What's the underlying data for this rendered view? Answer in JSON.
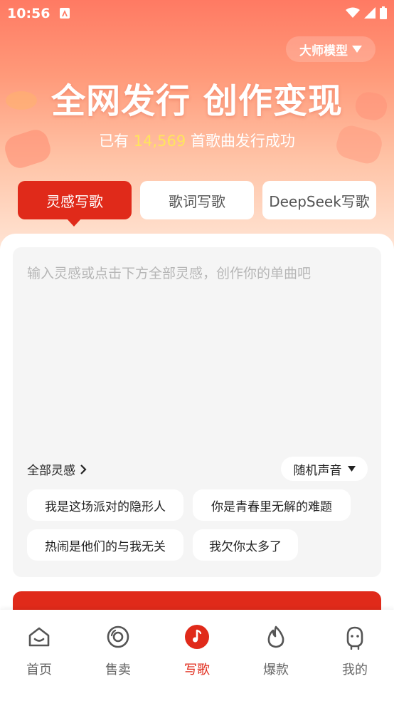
{
  "status_bar": {
    "time": "10:56"
  },
  "model_selector": {
    "label": "大师模型"
  },
  "hero": {
    "headline": "全网发行 创作变现",
    "sub_prefix": "已有",
    "count": "14,569",
    "sub_suffix": "首歌曲发行成功"
  },
  "tabs": [
    {
      "label": "灵感写歌"
    },
    {
      "label": "歌词写歌"
    },
    {
      "label": "DeepSeek写歌"
    }
  ],
  "editor": {
    "placeholder": "输入灵感或点击下方全部灵感，创作你的单曲吧",
    "all_inspiration": "全部灵感",
    "random_voice": "随机声音",
    "suggestions": [
      "我是这场派对的隐形人",
      "你是青春里无解的难题",
      "热闹是他们的与我无关",
      "我欠你太多了"
    ]
  },
  "nav": [
    {
      "label": "首页",
      "icon": "home-icon"
    },
    {
      "label": "售卖",
      "icon": "disc-icon"
    },
    {
      "label": "写歌",
      "icon": "music-note-icon"
    },
    {
      "label": "爆款",
      "icon": "flame-icon"
    },
    {
      "label": "我的",
      "icon": "profile-icon"
    }
  ],
  "colors": {
    "accent": "#e02a1a",
    "highlight": "#ffe55c"
  }
}
